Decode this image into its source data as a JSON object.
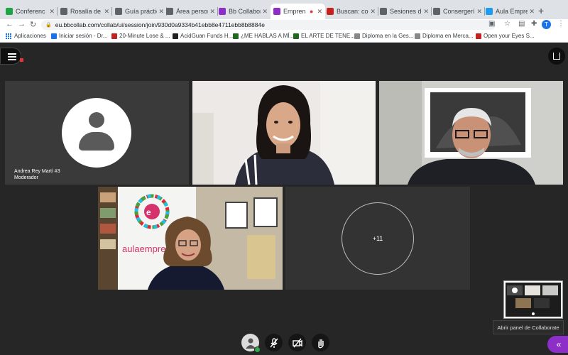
{
  "browser": {
    "tabs": [
      {
        "title": "Conferenc",
        "color": "#1ea446",
        "active": false
      },
      {
        "title": "Rosalía de",
        "color": "#5f6368",
        "active": false
      },
      {
        "title": "Guía práctic",
        "color": "#5f6368",
        "active": false
      },
      {
        "title": "Área person",
        "color": "#5f6368",
        "active": false
      },
      {
        "title": "Bb Collabor",
        "color": "#8e2ec8",
        "active": false
      },
      {
        "title": "Empren",
        "color": "#8e2ec8",
        "active": true
      },
      {
        "title": "Buscan: cool",
        "color": "#c5221f",
        "active": false
      },
      {
        "title": "Sesiones de",
        "color": "#5f6368",
        "active": false
      },
      {
        "title": "Consergería",
        "color": "#5f6368",
        "active": false
      },
      {
        "title": "Aula Empre",
        "color": "#1d9bf0",
        "active": false
      }
    ],
    "new_tab": "+",
    "url": "eu.bbcollab.com/collab/ui/session/join/930d0a9334b41ebb8e4711ebb8b8884e",
    "profile_initial": "T",
    "bookmarks": [
      {
        "label": "Aplicaciones",
        "color": "#1a73e8"
      },
      {
        "label": "Iniciar sesión - Dr...",
        "color": "#1a73e8"
      },
      {
        "label": "20-Minute Lose & ...",
        "color": "#c5221f"
      },
      {
        "label": "AcidGuan Funds H...",
        "color": "#222222"
      },
      {
        "label": "¿ME HABLAS A MÍ...",
        "color": "#1e6b1e"
      },
      {
        "label": "EL ARTE DE TENE...",
        "color": "#1e6b1e"
      },
      {
        "label": "Diploma en la Ges...",
        "color": "#888888"
      },
      {
        "label": "Diploma en Merca...",
        "color": "#888888"
      },
      {
        "label": "Open your Eyes S...",
        "color": "#c5221f"
      }
    ]
  },
  "session": {
    "participants": [
      {
        "name": "Andrea Rey Martí #3",
        "role": "Moderador"
      }
    ],
    "poster_text": "aulaempresa",
    "more_count": "+11",
    "mini_tooltip": "Abrir panel de Collaborate",
    "panel_icon": "«"
  },
  "colors": {
    "app_bg": "#262626",
    "panel_button": "#8e2ec8",
    "status_green": "#2fa84f"
  }
}
